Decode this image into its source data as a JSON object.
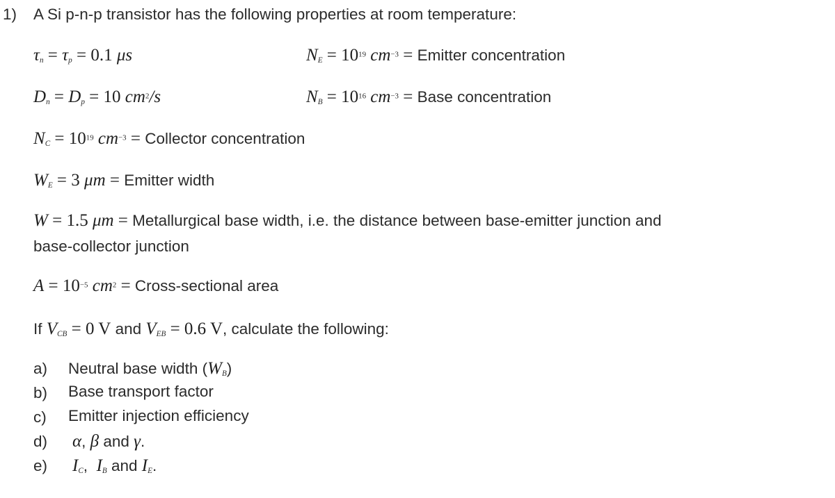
{
  "document": {
    "background_color": "#ffffff",
    "text_color": "#2b2b2b",
    "math_color": "#1f1f1f"
  },
  "problem": {
    "number": "1)",
    "stem": "A Si p-n-p transistor has the following properties at room temperature:"
  },
  "parameters": {
    "tau": {
      "symbol_1": "τ",
      "sub_1": "n",
      "eq_1": " = ",
      "symbol_2": "τ",
      "sub_2": "p",
      "eq_2": " = ",
      "value": "0.1",
      "unit": "μs",
      "full": "τn = τp = 0.1 μs"
    },
    "diffusion": {
      "symbol_1": "D",
      "sub_1": "n",
      "eq_1": " = ",
      "symbol_2": "D",
      "sub_2": "p",
      "eq_2": " = ",
      "value": "10",
      "unit": "cm",
      "unit_exp": "2",
      "unit_tail": "/s",
      "full": "Dn = Dp = 10 cm2/s"
    },
    "n_emitter": {
      "symbol": "N",
      "sub": "E",
      "eq_1": " = ",
      "mantissa": "10",
      "exponent": "19",
      "unit": "cm",
      "unit_exp": "−3",
      "eq_2": " = ",
      "description": "Emitter concentration"
    },
    "n_base": {
      "symbol": "N",
      "sub": "B",
      "eq_1": " = ",
      "mantissa": "10",
      "exponent": "16",
      "unit": "cm",
      "unit_exp": "−3",
      "eq_2": " = ",
      "description": "Base concentration"
    },
    "n_collector": {
      "symbol": "N",
      "sub": "C",
      "eq_1": " = ",
      "mantissa": "10",
      "exponent": "19",
      "unit": "cm",
      "unit_exp": "−3",
      "eq_2": " = ",
      "description": "Collector concentration"
    },
    "emitter_width": {
      "symbol": "W",
      "sub": "E",
      "eq_1": " = ",
      "value": "3",
      "unit": "μm",
      "eq_2": " = ",
      "description": "Emitter width"
    },
    "metallurgical_base_width": {
      "symbol": "W",
      "eq_1": " = ",
      "value": "1.5",
      "unit": "μm",
      "eq_2": " = ",
      "description": "Metallurgical base width, i.e. the distance between base-emitter junction and",
      "description_cont": "base-collector junction"
    },
    "area": {
      "symbol": "A",
      "eq_1": " = ",
      "mantissa": "10",
      "exponent": "−5",
      "unit": "cm",
      "unit_exp": "2",
      "eq_2": " = ",
      "description": "Cross-sectional area"
    }
  },
  "bias_condition": {
    "prefix": "If ",
    "v1_symbol": "V",
    "v1_sub": "CB",
    "v1_eq": " = ",
    "v1_value": "0 V",
    "conjunction": " and ",
    "v2_symbol": "V",
    "v2_sub": "EB",
    "v2_eq": " = ",
    "v2_value": "0.6 V",
    "suffix": ", calculate the following:",
    "full": "If VCB = 0 V and VEB = 0.6 V, calculate the following:"
  },
  "sub_questions": [
    {
      "label": "a)",
      "text_before": "Neutral base width (",
      "math_symbol": "W",
      "math_sub": "B",
      "text_after": ")",
      "full": "Neutral base width (WB)"
    },
    {
      "label": "b)",
      "text_before": "Base transport factor",
      "math_symbol": "",
      "math_sub": "",
      "text_after": "",
      "full": "Base transport factor"
    },
    {
      "label": "c)",
      "text_before": "Emitter injection efficiency",
      "math_symbol": "",
      "math_sub": "",
      "text_after": "",
      "full": "Emitter injection efficiency"
    },
    {
      "label": "d)",
      "alpha": "α",
      "comma": ", ",
      "beta": "β",
      "conjunction": " and ",
      "gamma": "γ",
      "period": ".",
      "full": "α, β and γ."
    },
    {
      "label": "e)",
      "i1": "I",
      "i1_sub": "C",
      "comma": ",  ",
      "i2": "I",
      "i2_sub": "B",
      "conjunction": " and ",
      "i3": "I",
      "i3_sub": "E",
      "period": ".",
      "full": "IC, IB and IE."
    }
  ]
}
